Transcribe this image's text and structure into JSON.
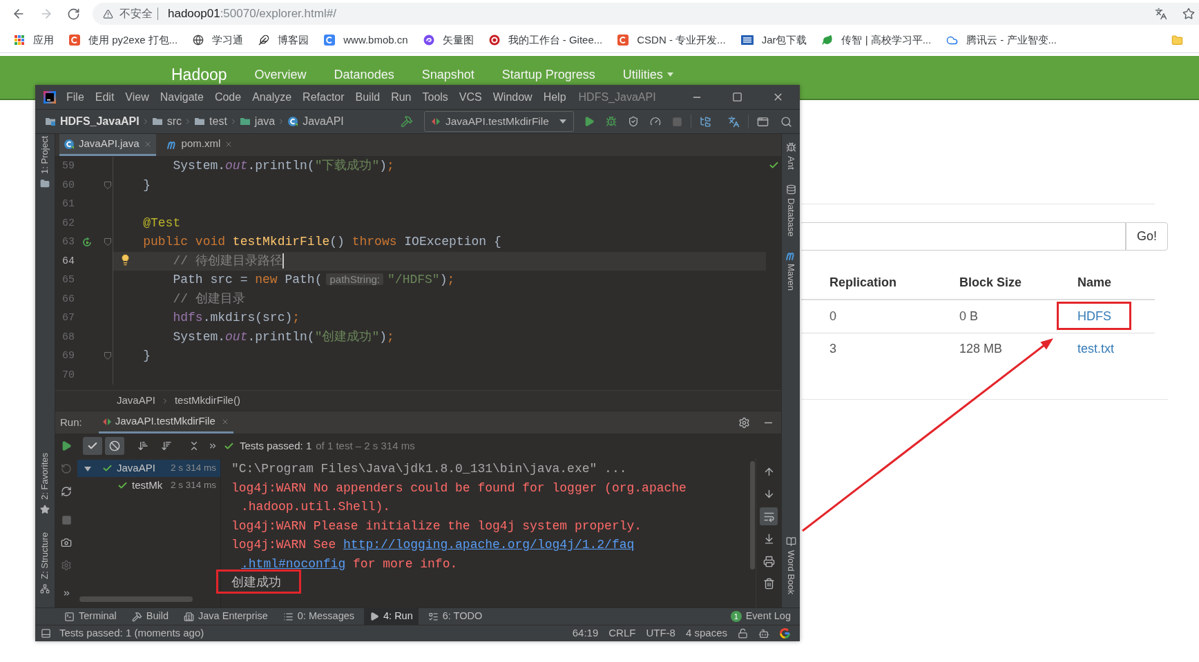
{
  "browser": {
    "address": {
      "security_label": "不安全",
      "host": "hadoop01",
      "path": ":50070/explorer.html#/"
    },
    "bookmarks": [
      {
        "label": "应用",
        "kind": "apps"
      },
      {
        "label": "使用 py2exe 打包...",
        "kind": "tile",
        "color": "#e9542f"
      },
      {
        "label": "学习通",
        "kind": "globe"
      },
      {
        "label": "博客园",
        "kind": "feather"
      },
      {
        "label": "www.bmob.cn",
        "kind": "tile",
        "color": "#3e86f5"
      },
      {
        "label": "矢量图",
        "kind": "swirl"
      },
      {
        "label": "我的工作台 - Gitee...",
        "kind": "seal"
      },
      {
        "label": "CSDN - 专业开发...",
        "kind": "tile",
        "color": "#e9542f"
      },
      {
        "label": "Jar包下载",
        "kind": "grid"
      },
      {
        "label": "传智 | 高校学习平...",
        "kind": "leaf"
      },
      {
        "label": "腾讯云 - 产业智变...",
        "kind": "cloud"
      }
    ]
  },
  "hadoop": {
    "navbar": {
      "brand": "Hadoop",
      "items": [
        {
          "label": "Overview",
          "dropdown": false
        },
        {
          "label": "Datanodes",
          "dropdown": false
        },
        {
          "label": "Snapshot",
          "dropdown": false
        },
        {
          "label": "Startup Progress",
          "dropdown": false
        },
        {
          "label": "Utilities",
          "dropdown": true
        }
      ]
    },
    "go_button": "Go!",
    "table": {
      "columns": [
        "Replication",
        "Block Size",
        "Name"
      ],
      "rows": [
        {
          "cells": [
            "0",
            "0 B",
            "HDFS"
          ],
          "highlighted": true
        },
        {
          "cells": [
            "3",
            "128 MB",
            "test.txt"
          ]
        }
      ]
    }
  },
  "ide": {
    "menu": [
      "File",
      "Edit",
      "View",
      "Navigate",
      "Code",
      "Analyze",
      "Refactor",
      "Build",
      "Run",
      "Tools",
      "VCS",
      "Window",
      "Help"
    ],
    "title": "HDFS_JavaAPI",
    "breadcrumbs": [
      {
        "label": "HDFS_JavaAPI",
        "kind": "project"
      },
      {
        "label": "src",
        "kind": "folder"
      },
      {
        "label": "test",
        "kind": "folder"
      },
      {
        "label": "java",
        "kind": "source"
      },
      {
        "label": "JavaAPI",
        "kind": "class"
      }
    ],
    "run_config": "JavaAPI.testMkdirFile",
    "left_tools": {
      "top": [
        {
          "label": "1: Project",
          "kind": "project"
        }
      ],
      "bottom": [
        {
          "label": "2: Favorites",
          "kind": "favorites"
        },
        {
          "label": "Z: Structure",
          "kind": "structure"
        }
      ]
    },
    "right_tools": {
      "top": [
        {
          "label": "Ant",
          "kind": "ant"
        },
        {
          "label": "Database",
          "kind": "database"
        },
        {
          "label": "Maven",
          "kind": "maven"
        }
      ],
      "bottom": [
        {
          "label": "Word Book",
          "kind": "book"
        }
      ]
    },
    "editor_tabs": [
      {
        "label": "JavaAPI.java",
        "kind": "class",
        "selected": true
      },
      {
        "label": "pom.xml",
        "kind": "maven",
        "selected": false
      }
    ],
    "code": [
      {
        "number": "59",
        "current": false,
        "tokens": [
          {
            "kind": "plain",
            "text": "        System."
          },
          {
            "kind": "static",
            "text": "out"
          },
          {
            "kind": "plain",
            "text": ".println("
          },
          {
            "kind": "string",
            "text": "\"下载成功\""
          },
          {
            "kind": "plain",
            "text": ")"
          },
          {
            "kind": "keyword",
            "text": ";"
          }
        ]
      },
      {
        "number": "60",
        "current": false,
        "fold_marker": true,
        "tokens": [
          {
            "kind": "plain",
            "text": "    }"
          }
        ]
      },
      {
        "number": "61",
        "current": false
      },
      {
        "number": "62",
        "current": false,
        "tokens": [
          {
            "kind": "annotation",
            "text": "    @Test"
          }
        ]
      },
      {
        "number": "63",
        "current": false,
        "run_marker": true,
        "fold_marker": true,
        "tokens": [
          {
            "kind": "keyword",
            "text": "    public void "
          },
          {
            "kind": "method",
            "text": "testMkdirFile"
          },
          {
            "kind": "plain",
            "text": "() "
          },
          {
            "kind": "keyword",
            "text": "throws "
          },
          {
            "kind": "plain",
            "text": "IOException {"
          }
        ]
      },
      {
        "number": "64",
        "current": true,
        "bulb": true,
        "tokens": [
          {
            "kind": "comment",
            "text": "        // 待创建目录路径"
          }
        ]
      },
      {
        "number": "65",
        "current": false,
        "tokens": [
          {
            "kind": "plain",
            "text": "        Path src = "
          },
          {
            "kind": "keyword",
            "text": "new "
          },
          {
            "kind": "plain",
            "text": "Path("
          },
          {
            "kind": "hint",
            "text": "pathString:"
          },
          {
            "kind": "string",
            "text": "\"/HDFS\""
          },
          {
            "kind": "plain",
            "text": ")"
          },
          {
            "kind": "keyword",
            "text": ";"
          }
        ]
      },
      {
        "number": "66",
        "current": false,
        "tokens": [
          {
            "kind": "comment",
            "text": "        // 创建目录"
          }
        ]
      },
      {
        "number": "67",
        "current": false,
        "tokens": [
          {
            "kind": "field",
            "text": "        hdfs"
          },
          {
            "kind": "plain",
            "text": ".mkdirs(src)"
          },
          {
            "kind": "keyword",
            "text": ";"
          }
        ]
      },
      {
        "number": "68",
        "current": false,
        "tokens": [
          {
            "kind": "plain",
            "text": "        System."
          },
          {
            "kind": "static",
            "text": "out"
          },
          {
            "kind": "plain",
            "text": ".println("
          },
          {
            "kind": "string",
            "text": "\"创建成功\""
          },
          {
            "kind": "plain",
            "text": ")"
          },
          {
            "kind": "keyword",
            "text": ";"
          }
        ]
      },
      {
        "number": "69",
        "current": false,
        "fold_marker": true,
        "tokens": [
          {
            "kind": "plain",
            "text": "    }"
          }
        ]
      },
      {
        "number": "70",
        "current": false
      }
    ],
    "code_breadcrumbs": [
      "JavaAPI",
      "testMkdirFile()"
    ],
    "run": {
      "label": "Run:",
      "tab": "JavaAPI.testMkdirFile",
      "toggles": [
        {
          "kind": "passed",
          "on": true
        },
        {
          "kind": "ignored",
          "on": true
        }
      ],
      "status": "Tests passed: 1",
      "status_detail": "of 1 test – 2 s 314 ms",
      "tree": [
        {
          "label": "JavaAPI",
          "time": "2 s 314 ms",
          "selected": true,
          "expanded": true,
          "children": [
            {
              "label": "testMk",
              "time": "2 s 314 ms",
              "selected": false
            }
          ]
        }
      ],
      "console": [
        {
          "kind": "command",
          "lines": [
            {
              "parts": [
                {
                  "kind": "text",
                  "text": "\"C:\\Program Files\\Java\\jdk1.8.0_131\\bin\\java.exe\" ..."
                }
              ]
            }
          ]
        },
        {
          "kind": "warn",
          "lines": [
            {
              "parts": [
                {
                  "kind": "text",
                  "text": "log4j:WARN No appenders could be found for logger (org.apache"
                }
              ]
            },
            {
              "parts": [
                {
                  "kind": "text",
                  "text": ".hadoop.util.Shell)."
                }
              ]
            }
          ]
        },
        {
          "kind": "warn",
          "lines": [
            {
              "parts": [
                {
                  "kind": "text",
                  "text": "log4j:WARN Please initialize the log4j system properly."
                }
              ]
            }
          ]
        },
        {
          "kind": "warn",
          "lines": [
            {
              "parts": [
                {
                  "kind": "text",
                  "text": "log4j:WARN See "
                },
                {
                  "kind": "link",
                  "text": "http://logging.apache.org/log4j/1.2/faq"
                }
              ]
            },
            {
              "parts": [
                {
                  "kind": "link",
                  "text": ".html#noconfig"
                },
                {
                  "kind": "text",
                  "text": " for more info."
                }
              ]
            }
          ]
        },
        {
          "kind": "output",
          "highlighted": true,
          "lines": [
            {
              "parts": [
                {
                  "kind": "text",
                  "text": "创建成功"
                }
              ]
            }
          ]
        }
      ],
      "console_tools": [
        {
          "kind": "up"
        },
        {
          "kind": "down"
        },
        {
          "kind": "wrap",
          "on": true
        },
        {
          "kind": "scroll"
        },
        {
          "kind": "print"
        },
        {
          "kind": "clear"
        }
      ]
    },
    "tool_tabs": [
      {
        "label": "Terminal",
        "kind": "terminal",
        "selected": false
      },
      {
        "label": "Build",
        "kind": "build",
        "selected": false
      },
      {
        "label": "Java Enterprise",
        "kind": "enterprise",
        "selected": false
      },
      {
        "label": "0: Messages",
        "kind": "messages",
        "selected": false
      },
      {
        "label": "4: Run",
        "kind": "run",
        "selected": true
      },
      {
        "label": "6: TODO",
        "kind": "todo",
        "selected": false
      }
    ],
    "event_log": {
      "count": "1",
      "label": "Event Log"
    },
    "status_bar": {
      "message": "Tests passed: 1 (moments ago)",
      "items": [
        "64:19",
        "CRLF",
        "UTF-8",
        "4 spaces"
      ]
    }
  }
}
